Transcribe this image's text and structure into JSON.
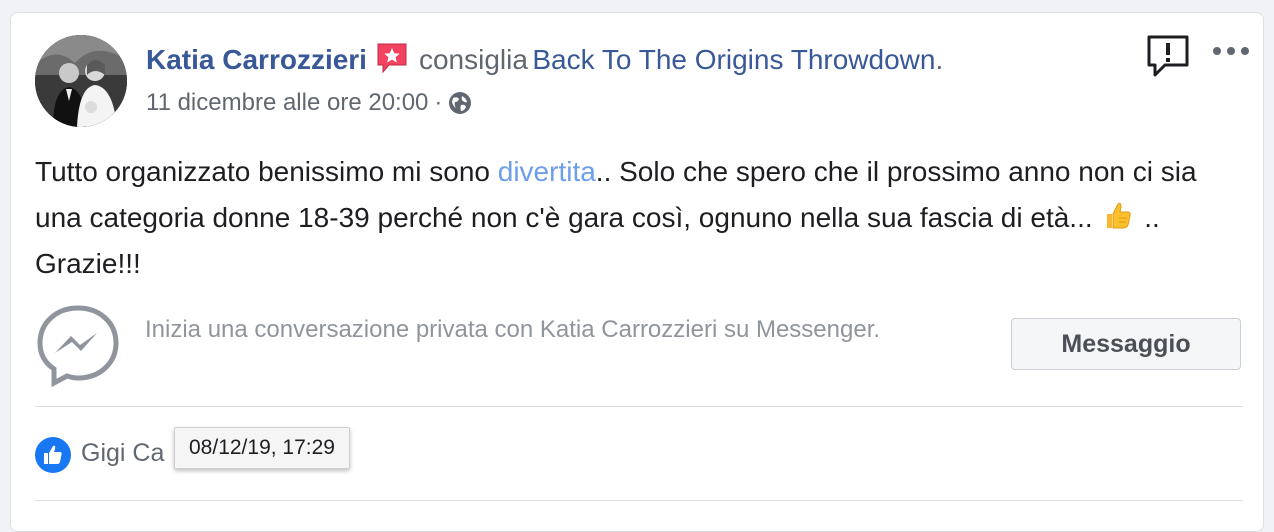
{
  "post": {
    "author": "Katia Carrozzieri",
    "action": "consiglia",
    "page": "Back To The Origins Throwdown",
    "period": ".",
    "timestamp": "11 dicembre alle ore 20:00",
    "separator": "·",
    "audience_icon": "globe-icon",
    "badge_icon": "recommendation-star-icon",
    "text_part1": "Tutto organizzato benissimo mi sono ",
    "text_highlight": "divertita",
    "text_part2": ".. Solo che spero che il prossimo anno non ci sia una categoria donne 18-39 perché non c'è gara così, ognuno nella sua fascia di età... ",
    "text_emoji": "thumbs-up",
    "text_part3": " .. Grazie!!!"
  },
  "messenger": {
    "prompt": "Inizia una conversazione privata con Katia Carrozzieri su Messenger.",
    "button_label": "Messaggio"
  },
  "reactions": {
    "liker": "Gigi Ca",
    "tooltip": "08/12/19, 17:29"
  },
  "colors": {
    "link": "#385898",
    "highlight": "#6d9eeb",
    "secondary_text": "#606770",
    "like_blue": "#1877f2",
    "badge_red": "#f3425f"
  }
}
